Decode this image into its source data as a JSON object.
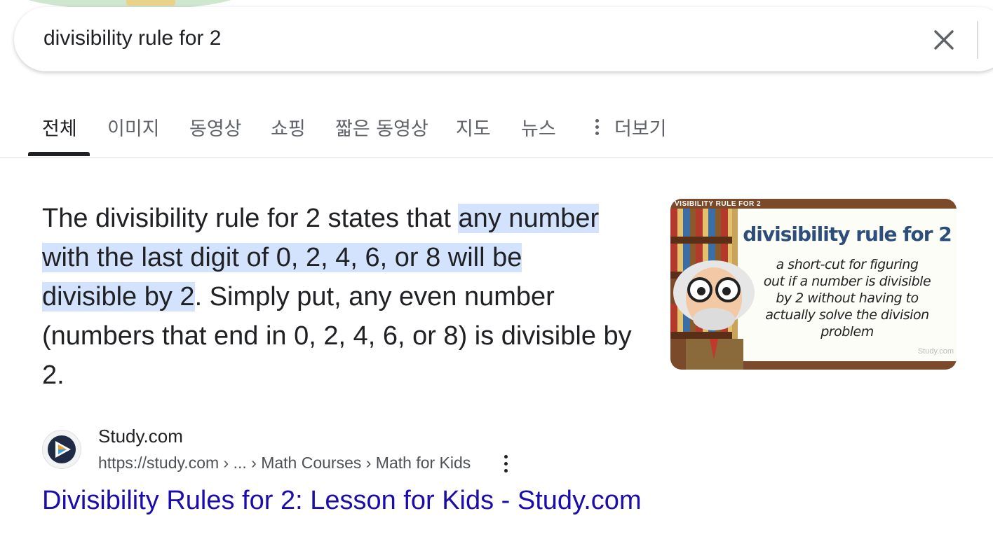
{
  "search": {
    "query": "divisibility rule for 2"
  },
  "tabs": [
    {
      "label": "전체",
      "active": true
    },
    {
      "label": "이미지"
    },
    {
      "label": "동영상"
    },
    {
      "label": "쇼핑"
    },
    {
      "label": "짧은 동영상"
    },
    {
      "label": "지도"
    },
    {
      "label": "뉴스"
    },
    {
      "label": "더보기"
    }
  ],
  "snippet": {
    "before": "The divisibility rule for 2 states that ",
    "highlight_1": "any number",
    "highlight_2": "with the last digit of 0, 2, 4, 6, or 8 will be",
    "highlight_3": "divisible by 2",
    "after": ". Simply put, any even number (numbers that end in 0, 2, 4, 6, or 8) is divisible by 2.",
    "highlight_color": "#d3e3fd"
  },
  "thumbnail": {
    "corner_label": "VISIBILITY RULE FOR 2",
    "title": "divisibility rule for 2",
    "body_lines": [
      "a short-cut for figuring",
      "out if a number is divisible",
      "by 2 without having to",
      "actually solve the division",
      "problem"
    ],
    "credit": "Study.com"
  },
  "source": {
    "site_name": "Study.com",
    "breadcrumb": "https://study.com › ... › Math Courses › Math for Kids",
    "title": "Divisibility Rules for 2: Lesson for Kids - Study.com",
    "link_color": "#1a0dab"
  },
  "icons": {
    "clear": "close-icon",
    "more": "more-vert-icon",
    "favicon": "study-com-logo-icon"
  }
}
